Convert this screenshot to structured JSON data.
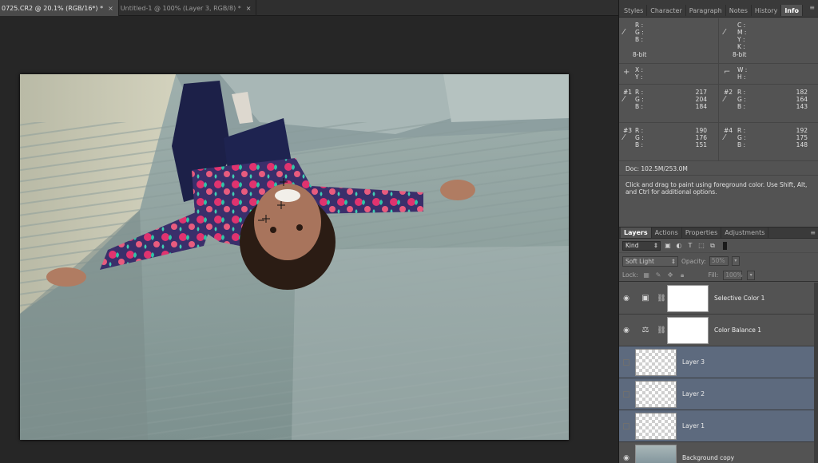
{
  "document_tabs": [
    {
      "label": "0725.CR2 @ 20.1% (RGB/16*) *",
      "active": true
    },
    {
      "label": "Untitled-1 @ 100% (Layer 3, RGB/8) *",
      "active": false
    }
  ],
  "close_glyph": "×",
  "info_panel": {
    "tabs": [
      "Styles",
      "Character",
      "Paragraph",
      "Notes",
      "History",
      "Info"
    ],
    "active_tab": "Info",
    "rgb_labels": [
      "R :",
      "G :",
      "B :"
    ],
    "cmyk_labels": [
      "C :",
      "M :",
      "Y :",
      "K :"
    ],
    "bit_left": "8-bit",
    "bit_right": "8-bit",
    "xy_labels": [
      "X :",
      "Y :"
    ],
    "wh_labels": [
      "W :",
      "H :"
    ],
    "samplers": [
      {
        "id": "#1",
        "R": "217",
        "G": "204",
        "B": "184"
      },
      {
        "id": "#2",
        "R": "182",
        "G": "164",
        "B": "143"
      },
      {
        "id": "#3",
        "R": "190",
        "G": "176",
        "B": "151"
      },
      {
        "id": "#4",
        "R": "192",
        "G": "175",
        "B": "148"
      }
    ],
    "doc_size": "Doc: 102.5M/253.0M",
    "hint": "Click and drag to paint using foreground color.  Use Shift, Alt, and Ctrl for additional options."
  },
  "layers_panel": {
    "tabs": [
      "Layers",
      "Actions",
      "Properties",
      "Adjustments"
    ],
    "active_tab": "Layers",
    "filter_kind": "Kind",
    "blend_mode": "Soft Light",
    "opacity_label": "Opacity:",
    "opacity_value": "50%",
    "lock_label": "Lock:",
    "fill_label": "Fill:",
    "fill_value": "100%",
    "layers": [
      {
        "name": "Selective Color 1",
        "type": "adjustment",
        "visible": true,
        "selected": false
      },
      {
        "name": "Color Balance 1",
        "type": "adjustment",
        "visible": true,
        "selected": false
      },
      {
        "name": "Layer 3",
        "type": "pixel",
        "visible": false,
        "selected": true
      },
      {
        "name": "Layer 2",
        "type": "pixel",
        "visible": false,
        "selected": true
      },
      {
        "name": "Layer 1",
        "type": "pixel",
        "visible": false,
        "selected": true
      },
      {
        "name": "Background copy",
        "type": "photo",
        "visible": true,
        "selected": false
      }
    ]
  },
  "colors": {
    "selected_layer": "#5d6a7e",
    "panel_bg": "#535353",
    "workspace_bg": "#262626"
  }
}
